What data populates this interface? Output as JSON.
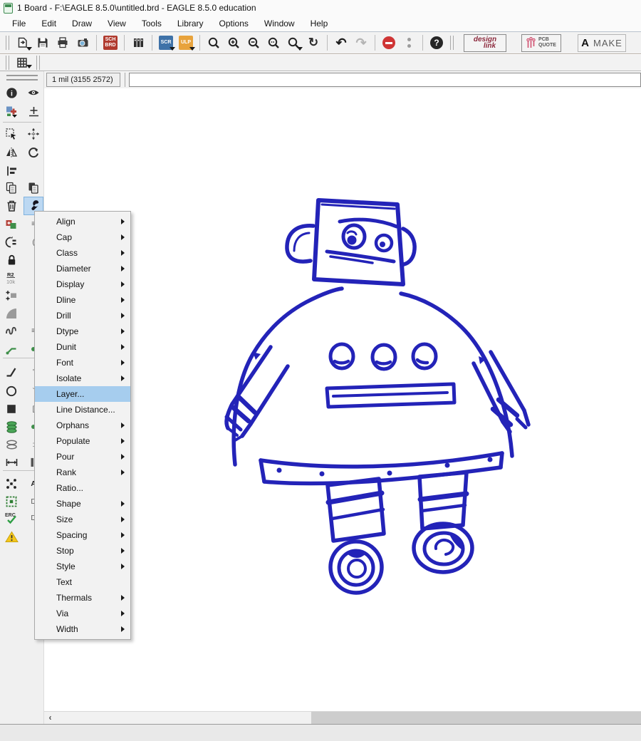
{
  "window": {
    "title": "1 Board - F:\\EAGLE 8.5.0\\untitled.brd - EAGLE 8.5.0 education"
  },
  "menubar": {
    "items": [
      "File",
      "Edit",
      "Draw",
      "View",
      "Tools",
      "Library",
      "Options",
      "Window",
      "Help"
    ]
  },
  "toolbar": {
    "schbrd": {
      "line1": "SCH",
      "line2": "BRD"
    },
    "scr_label": "SCR",
    "ulp_label": "ULP",
    "undo_glyph": "↶",
    "redo_glyph": "↷",
    "refresh_glyph": "↻",
    "help_glyph": "?",
    "design_link": {
      "line1": "design",
      "line2": "link"
    },
    "pcb_quote": {
      "line1": "PCB",
      "line2": "QUOTE"
    },
    "make_label": "MAKE",
    "make_logo": "A"
  },
  "param_bar": {
    "coordinates": "1 mil (3155 2572)",
    "command_value": ""
  },
  "sidebar": {
    "name_value_top": "R2",
    "name_value_bottom": "10k",
    "erc_label": "ERC",
    "fragments": {
      "f302": "≡",
      "f328": "(",
      "f452": "≡",
      "f510": "'",
      "f537": "`",
      "f562": "[",
      "f612": ":",
      "f637": "▌",
      "f667": "A",
      "f692": "D",
      "f715": "D"
    }
  },
  "scrollbar": {
    "left_arrow": "‹"
  },
  "context_menu": {
    "items": [
      {
        "label": "Align",
        "submenu": true
      },
      {
        "label": "Cap",
        "submenu": true
      },
      {
        "label": "Class",
        "submenu": true
      },
      {
        "label": "Diameter",
        "submenu": true
      },
      {
        "label": "Display",
        "submenu": true
      },
      {
        "label": "Dline",
        "submenu": true
      },
      {
        "label": "Drill",
        "submenu": true
      },
      {
        "label": "Dtype",
        "submenu": true
      },
      {
        "label": "Dunit",
        "submenu": true
      },
      {
        "label": "Font",
        "submenu": true
      },
      {
        "label": "Isolate",
        "submenu": true
      },
      {
        "label": "Layer...",
        "submenu": false,
        "highlighted": true
      },
      {
        "label": "Line Distance...",
        "submenu": false
      },
      {
        "label": "Orphans",
        "submenu": true
      },
      {
        "label": "Populate",
        "submenu": true
      },
      {
        "label": "Pour",
        "submenu": true
      },
      {
        "label": "Rank",
        "submenu": true
      },
      {
        "label": "Ratio...",
        "submenu": false
      },
      {
        "label": "Shape",
        "submenu": true
      },
      {
        "label": "Size",
        "submenu": true
      },
      {
        "label": "Spacing",
        "submenu": true
      },
      {
        "label": "Stop",
        "submenu": true
      },
      {
        "label": "Style",
        "submenu": true
      },
      {
        "label": "Text",
        "submenu": false
      },
      {
        "label": "Thermals",
        "submenu": true
      },
      {
        "label": "Via",
        "submenu": true
      },
      {
        "label": "Width",
        "submenu": true
      }
    ]
  },
  "canvas": {
    "content": "hand-drawn robot sketch",
    "stroke_color": "#2323b8"
  },
  "colors": {
    "menu_highlight": "#a6cdee",
    "active_tool_bg": "#bcd8f2",
    "robot_blue": "#2323b8",
    "schbrd_red": "#b03a2e",
    "scr_blue": "#3f72a8",
    "ulp_orange": "#e8a33c",
    "stop_red": "#cf3535",
    "warning_yellow": "#f5c71a",
    "erc_green": "#2e9e44"
  }
}
